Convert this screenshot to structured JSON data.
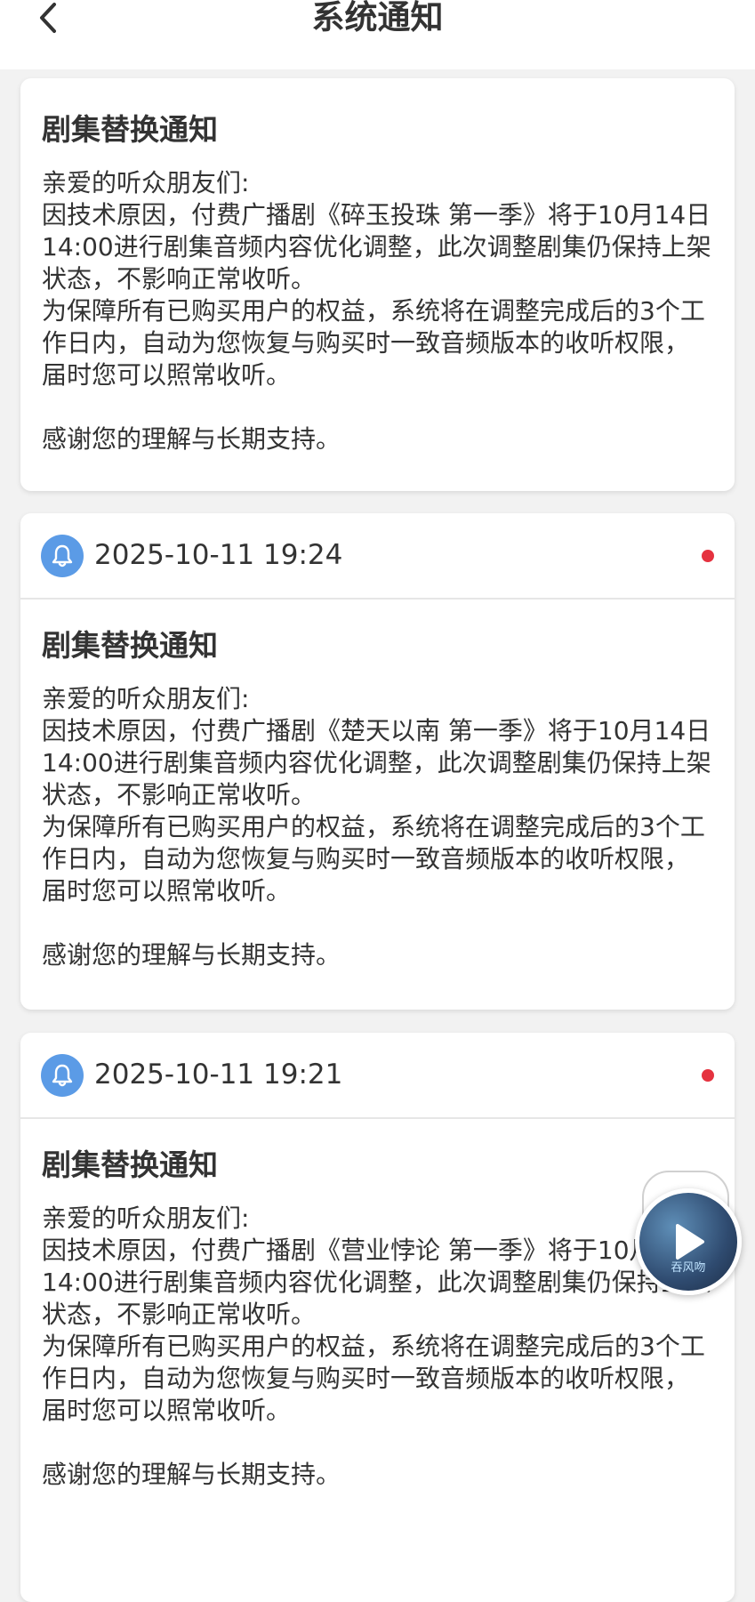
{
  "header": {
    "title": "系统通知"
  },
  "notifications": [
    {
      "title": "剧集替换通知",
      "body": "亲爱的听众朋友们:\n因技术原因，付费广播剧《碎玉投珠 第一季》将于10月14日14:00进行剧集音频内容优化调整，此次调整剧集仍保持上架状态，不影响正常收听。\n为保障所有已购买用户的权益，系统将在调整完成后的3个工作日内，自动为您恢复与购买时一致音频版本的收听权限，届时您可以照常收听。\n\n感谢您的理解与长期支持。"
    },
    {
      "time": "2025-10-11 19:24",
      "unread": true,
      "title": "剧集替换通知",
      "body": "亲爱的听众朋友们:\n因技术原因，付费广播剧《楚天以南 第一季》将于10月14日14:00进行剧集音频内容优化调整，此次调整剧集仍保持上架状态，不影响正常收听。\n为保障所有已购买用户的权益，系统将在调整完成后的3个工作日内，自动为您恢复与购买时一致音频版本的收听权限，届时您可以照常收听。\n\n感谢您的理解与长期支持。"
    },
    {
      "time": "2025-10-11 19:21",
      "unread": true,
      "title": "剧集替换通知",
      "body": "亲爱的听众朋友们:\n因技术原因，付费广播剧《营业悖论 第一季》将于10月14日14:00进行剧集音频内容优化调整，此次调整剧集仍保持上架状态，不影响正常收听。\n为保障所有已购买用户的权益，系统将在调整完成后的3个工作日内，自动为您恢复与购买时一致音频版本的收听权限，届时您可以照常收听。\n\n感谢您的理解与长期支持。"
    }
  ],
  "float_player": {
    "caption": "吞风吻"
  },
  "colors": {
    "accent_blue": "#5b9be6",
    "unread_red": "#e5323f",
    "background": "#f2f2f2"
  }
}
